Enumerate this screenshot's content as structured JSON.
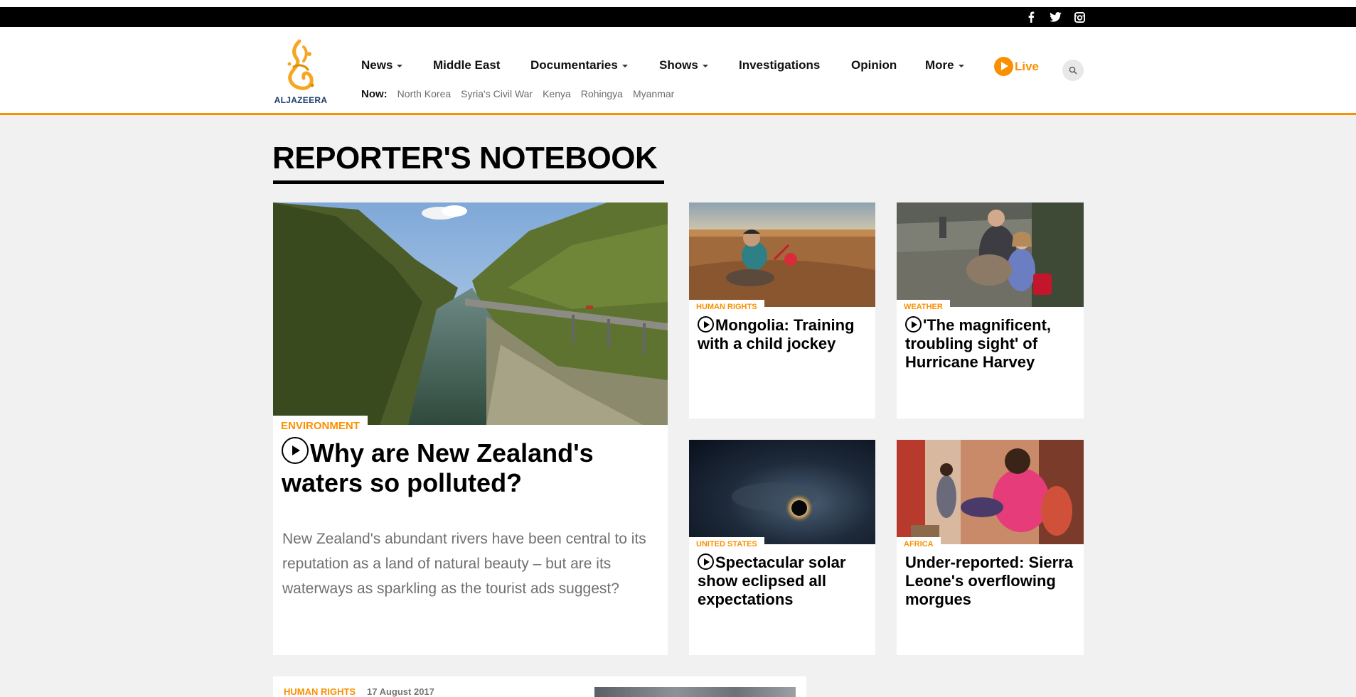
{
  "social": [
    {
      "name": "facebook"
    },
    {
      "name": "twitter"
    },
    {
      "name": "instagram"
    }
  ],
  "logo": {
    "text": "ALJAZEERA"
  },
  "nav": {
    "items": [
      {
        "label": "News",
        "dropdown": true
      },
      {
        "label": "Middle East",
        "dropdown": false
      },
      {
        "label": "Documentaries",
        "dropdown": true
      },
      {
        "label": "Shows",
        "dropdown": true
      },
      {
        "label": "Investigations",
        "dropdown": false
      },
      {
        "label": "Opinion",
        "dropdown": false
      },
      {
        "label": "More",
        "dropdown": true
      }
    ],
    "live_label": "Live",
    "now_label": "Now:",
    "now_links": [
      "North Korea",
      "Syria's Civil War",
      "Kenya",
      "Rohingya",
      "Myanmar"
    ]
  },
  "page": {
    "title": "REPORTER'S NOTEBOOK"
  },
  "featured": {
    "category": "ENVIRONMENT",
    "headline": "Why are New Zealand's waters so polluted?",
    "summary": "New Zealand's abundant rivers have been central to its reputation as a land of natural beauty – but are its waterways as sparkling as the tourist ads suggest?",
    "video": true
  },
  "cards": [
    {
      "category": "HUMAN RIGHTS",
      "headline": "Mongolia: Training with a child jockey",
      "video": true
    },
    {
      "category": "WEATHER",
      "headline": "'The magnificent, troubling sight' of Hurricane Harvey",
      "video": true
    },
    {
      "category": "UNITED STATES",
      "headline": "Spectacular solar show eclipsed all expectations",
      "video": true
    },
    {
      "category": "AFRICA",
      "headline": "Under-reported: Sierra Leone's overflowing morgues",
      "video": false
    }
  ],
  "bottom_teaser": {
    "category": "HUMAN RIGHTS",
    "date": "17 August 2017"
  },
  "colors": {
    "accent": "#fa9000",
    "background": "#f1f1f1",
    "topbar": "#000000",
    "logo_text": "#1b3b6b"
  }
}
